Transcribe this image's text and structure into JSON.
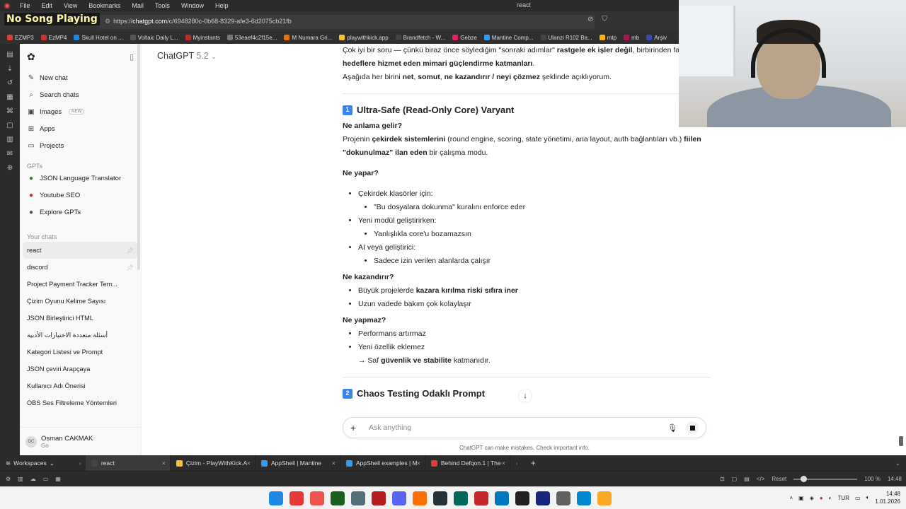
{
  "browser": {
    "menu": [
      "File",
      "Edit",
      "View",
      "Bookmarks",
      "Mail",
      "Tools",
      "Window",
      "Help"
    ],
    "window_title": "react",
    "url_prefix": "https://",
    "url_domain": "chatgpt.com",
    "url_path": "/c/6948280c-0b68-8329-afe3-6d2075cb21fb",
    "now_playing": "No Song Playing",
    "bookmarks": [
      {
        "label": "EZMP3",
        "color": "#e53935"
      },
      {
        "label": "EzMP4",
        "color": "#d32f2f"
      },
      {
        "label": "Skull Hotel on ...",
        "color": "#1e88e5"
      },
      {
        "label": "Voltaic Daily L...",
        "color": "#555555"
      },
      {
        "label": "Myinstants",
        "color": "#c62828"
      },
      {
        "label": "53eaef4c2f15e...",
        "color": "#777777"
      },
      {
        "label": "M Numara Gri...",
        "color": "#ef6c00"
      },
      {
        "label": "playwithkick.app",
        "color": "#fbc02d"
      },
      {
        "label": "Brandfetch - W...",
        "color": "#424242"
      },
      {
        "label": "Gebze",
        "color": "#e91e63"
      },
      {
        "label": "Mantine Comp...",
        "color": "#339af0"
      },
      {
        "label": "Ulanzi R102 Ba...",
        "color": "#444444"
      },
      {
        "label": "mtp",
        "color": "#ffb300"
      },
      {
        "label": "mb",
        "color": "#ad1457"
      },
      {
        "label": "Arşiv",
        "color": "#3949ab"
      }
    ]
  },
  "sidebar": {
    "nav": [
      {
        "label": "New chat",
        "icon": "edit-icon",
        "glyph": "✎"
      },
      {
        "label": "Search chats",
        "icon": "search-icon",
        "glyph": "⌕"
      },
      {
        "label": "Images",
        "icon": "image-icon",
        "glyph": "▣",
        "badge": "NEW"
      },
      {
        "label": "Apps",
        "icon": "grid-icon",
        "glyph": "⊞"
      },
      {
        "label": "Projects",
        "icon": "folder-icon",
        "glyph": "▭"
      }
    ],
    "gpts_title": "GPTs",
    "gpts": [
      {
        "label": "JSON Language Translator",
        "color": "#2e7d32"
      },
      {
        "label": "Youtube SEO",
        "color": "#c62828"
      },
      {
        "label": "Explore GPTs",
        "color": "#555555"
      }
    ],
    "chats_title": "Your chats",
    "chats": [
      {
        "label": "react",
        "pinned": true,
        "active": true
      },
      {
        "label": "discord",
        "pinned": true,
        "active": false
      },
      {
        "label": "Project Payment Tracker Tem...",
        "pinned": false,
        "active": false
      },
      {
        "label": "Çizim Oyunu Kelime Sayısı",
        "pinned": false,
        "active": false
      },
      {
        "label": "JSON Birleştirici HTML",
        "pinned": false,
        "active": false
      },
      {
        "label": "أسئلة متعددة الاختيارات الأدبية",
        "pinned": false,
        "active": false
      },
      {
        "label": "Kategori Listesi ve Prompt",
        "pinned": false,
        "active": false
      },
      {
        "label": "JSON çeviri Arapçaya",
        "pinned": false,
        "active": false
      },
      {
        "label": "Kullanıcı Adı Önerisi",
        "pinned": false,
        "active": false
      },
      {
        "label": "OBS Ses Filtreleme Yöntemleri",
        "pinned": false,
        "active": false
      }
    ],
    "user": {
      "name": "Osman CAKMAK",
      "plan": "Go",
      "initials": "OC"
    }
  },
  "main": {
    "model_name": "ChatGPT",
    "model_version": "5.2",
    "intro_1": "Çok iyi bir soru — çünkü biraz önce söylediğim \"sonraki adımlar\"",
    "intro_1b": "rastgele ek işler değil",
    "intro_1c": ", birbirinden fa",
    "intro_2": "hedeflere hizmet eden mimari güçlendirme katmanları",
    "intro_3a": "Aşağıda her birini ",
    "intro_3b": "net",
    "intro_3c": ", ",
    "intro_3d": "somut",
    "intro_3e": "ne kazandırır / neyi çözmez",
    "intro_3f": " şeklinde açıklıyorum.",
    "section1": {
      "num": "1",
      "title": "Ultra-Safe (Read-Only Core) Varyant",
      "q1": "Ne anlama gelir?",
      "a1_1": "Projenin ",
      "a1_2": "çekirdek sistemlerini",
      "a1_3": " (round engine, scoring, state yönetimi, ana layout, auth bağlantıları vb.) ",
      "a1_4": "fiilen",
      "a1_5": "\"dokunulmaz\" ilan eden",
      "a1_6": " bir çalışma modu.",
      "q2": "Ne yapar?",
      "does": [
        {
          "text": "Çekirdek klasörler için:",
          "sub": "\"Bu dosyalara dokunma\" kuralını enforce eder"
        },
        {
          "text": "Yeni modül geliştirirken:",
          "sub": "Yanlışlıkla core'u bozamazsın"
        },
        {
          "text": "AI veya geliştirici:",
          "sub": "Sadece izin verilen alanlarda çalışır"
        }
      ],
      "q3": "Ne kazandırır?",
      "gain_1a": "Büyük projelerde ",
      "gain_1b": "kazara kırılma riski sıfıra iner",
      "gain_2": "Uzun vadede bakım çok kolaylaşır",
      "q4": "Ne yapmaz?",
      "not_1": "Performans artırmaz",
      "not_2": "Yeni özellik eklemez",
      "arrow_a": "→ Saf ",
      "arrow_b": "güvenlik ve stabilite",
      "arrow_c": " katmanıdır."
    },
    "section2": {
      "num": "2",
      "title": "Chaos Testing Odaklı Prompt"
    },
    "composer_placeholder": "Ask anything",
    "disclaimer": "ChatGPT can make mistakes. Check important info."
  },
  "tabs": {
    "workspaces_label": "Workspaces",
    "items": [
      {
        "label": "react",
        "color": "#444444",
        "active": true
      },
      {
        "label": "Çizim - PlayWithKick.A",
        "color": "#fbc02d",
        "active": false
      },
      {
        "label": "AppShell | Mantine",
        "color": "#339af0",
        "active": false
      },
      {
        "label": "AppShell examples | M",
        "color": "#339af0",
        "active": false
      },
      {
        "label": "Behind Defqon.1 | The",
        "color": "#e53935",
        "active": false
      }
    ]
  },
  "statusbar": {
    "reset": "Reset",
    "zoom": "100 %",
    "time": "14:48"
  },
  "taskbar": {
    "lang": "TUR",
    "time": "14:48",
    "date": "1.01.2026",
    "apps": [
      {
        "name": "windows-start-icon",
        "color": "#1e88e5"
      },
      {
        "name": "chrome-icon",
        "color": "#e53935"
      },
      {
        "name": "vivaldi-icon",
        "color": "#ef5350"
      },
      {
        "name": "terminal-icon",
        "color": "#1b5e20"
      },
      {
        "name": "git-icon",
        "color": "#546e7a"
      },
      {
        "name": "filezilla-icon",
        "color": "#b71c1c"
      },
      {
        "name": "discord-icon",
        "color": "#5865f2"
      },
      {
        "name": "illustrator-icon",
        "color": "#ff6f00"
      },
      {
        "name": "figma-icon",
        "color": "#263238"
      },
      {
        "name": "monitor-icon",
        "color": "#00695c"
      },
      {
        "name": "record-icon",
        "color": "#c62828"
      },
      {
        "name": "vscode-icon",
        "color": "#0277bd"
      },
      {
        "name": "obs-icon",
        "color": "#212121"
      },
      {
        "name": "steam-icon",
        "color": "#1a237e"
      },
      {
        "name": "settings-icon",
        "color": "#616161"
      },
      {
        "name": "notepad-icon",
        "color": "#0288d1"
      },
      {
        "name": "explorer-icon",
        "color": "#f9a825"
      }
    ]
  }
}
